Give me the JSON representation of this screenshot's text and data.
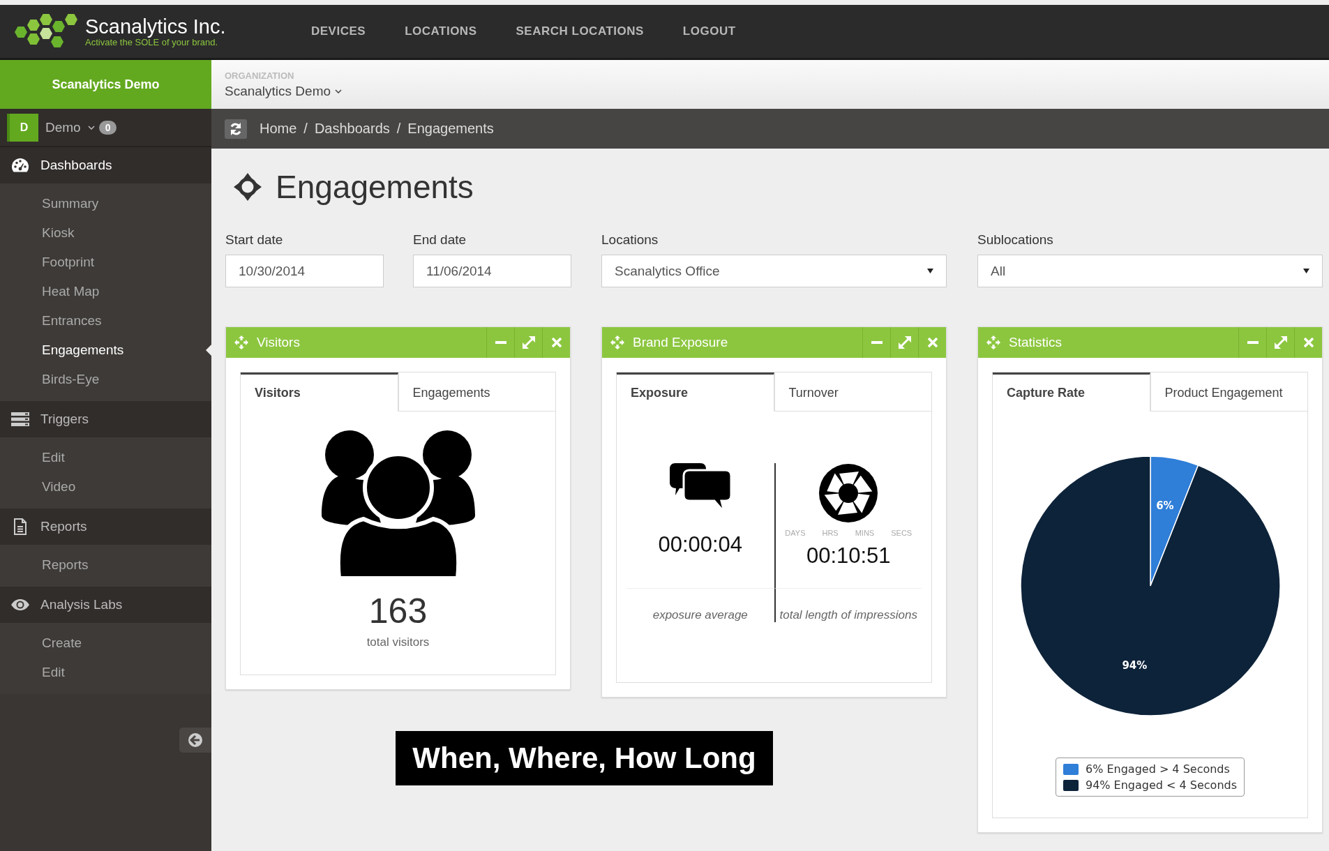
{
  "brand": {
    "name": "Scanalytics Inc.",
    "tagline": "Activate the SOLE of your brand."
  },
  "top_nav": [
    "DEVICES",
    "LOCATIONS",
    "SEARCH LOCATIONS",
    "LOGOUT"
  ],
  "sidebar": {
    "org_title": "Scanalytics Demo",
    "user": {
      "initial": "D",
      "name": "Demo",
      "badge": "0"
    },
    "sections": [
      {
        "label": "Dashboards",
        "selected": true,
        "items": [
          {
            "label": "Summary",
            "selected": false
          },
          {
            "label": "Kiosk",
            "selected": false
          },
          {
            "label": "Footprint",
            "selected": false
          },
          {
            "label": "Heat Map",
            "selected": false
          },
          {
            "label": "Entrances",
            "selected": false
          },
          {
            "label": "Engagements",
            "selected": true
          },
          {
            "label": "Birds-Eye",
            "selected": false
          }
        ]
      },
      {
        "label": "Triggers",
        "selected": false,
        "items": [
          {
            "label": "Edit",
            "selected": false
          },
          {
            "label": "Video",
            "selected": false
          }
        ]
      },
      {
        "label": "Reports",
        "selected": false,
        "items": [
          {
            "label": "Reports",
            "selected": false
          }
        ]
      },
      {
        "label": "Analysis Labs",
        "selected": false,
        "items": [
          {
            "label": "Create",
            "selected": false
          },
          {
            "label": "Edit",
            "selected": false
          }
        ]
      }
    ]
  },
  "organization": {
    "label": "ORGANIZATION",
    "value": "Scanalytics Demo"
  },
  "breadcrumb": [
    {
      "label": "Home"
    },
    {
      "separator": "/",
      "label": "Dashboards"
    },
    {
      "separator": "/",
      "label": "Engagements"
    }
  ],
  "page_title": "Engagements",
  "filters": [
    {
      "kind": "text",
      "label": "Start date",
      "value": "10/30/2014"
    },
    {
      "kind": "text",
      "label": "End date",
      "value": "11/06/2014"
    },
    {
      "kind": "select",
      "label": "Locations",
      "value": "Scanalytics Office"
    },
    {
      "kind": "select",
      "label": "Sublocations",
      "value": "All"
    }
  ],
  "widgets": [
    {
      "kind": "visitors",
      "title": "Visitors",
      "tabs": [
        {
          "label": "Visitors",
          "selected": true
        },
        {
          "label": "Engagements",
          "selected": false
        }
      ],
      "count": "163",
      "caption": "total visitors"
    },
    {
      "kind": "exposure",
      "title": "Brand Exposure",
      "tabs": [
        {
          "label": "Exposure",
          "selected": true
        },
        {
          "label": "Turnover",
          "selected": false
        }
      ],
      "stats": [
        {
          "value": "00:00:04",
          "caption": "exposure average"
        },
        {
          "units": [
            "DAYS",
            "HRS",
            "MINS",
            "SECS"
          ],
          "value": "00:10:51",
          "caption": "total length of impressions"
        }
      ]
    },
    {
      "kind": "pie",
      "title": "Statistics",
      "tabs": [
        {
          "label": "Capture Rate",
          "selected": true
        },
        {
          "label": "Product Engagement",
          "selected": false
        }
      ],
      "chart_data": {
        "type": "pie",
        "categories": [
          "6% Engaged > 4 Seconds",
          "94% Engaged < 4 Seconds"
        ],
        "values": [
          6,
          94
        ],
        "colors": [
          "#2f7ed8",
          "#0d233a"
        ],
        "value_labels": [
          "6%",
          "94%"
        ]
      }
    }
  ],
  "caption": "When, Where, How Long"
}
